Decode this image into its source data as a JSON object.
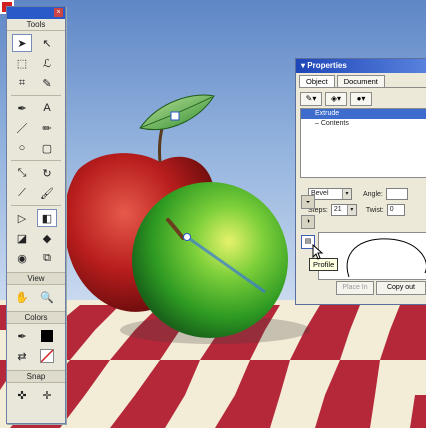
{
  "tools_palette": {
    "title": "Tools",
    "view_label": "View",
    "colors_label": "Colors",
    "snap_label": "Snap"
  },
  "properties_panel": {
    "title": "Properties",
    "tabs": [
      "Object",
      "Document"
    ],
    "tree_items": [
      "Extrude",
      "Contents"
    ],
    "bevel_label": "Bevel",
    "angle_label": "Angle:",
    "steps_label": "Steps:",
    "steps_value": "21",
    "twist_label": "Twist:",
    "twist_value": "0",
    "place_in_label": "Place In",
    "copy_out_label": "Copy out"
  },
  "tooltip": "Profile",
  "colors": {
    "sky_top": "#5f86c6",
    "panel_bg": "#ece9d8",
    "title_bar": "#1f46b8",
    "checker_red": "#b4283a",
    "checker_cream": "#f3ecd6",
    "red_apple": "#b81d1d",
    "green_apple": "#49b432"
  }
}
